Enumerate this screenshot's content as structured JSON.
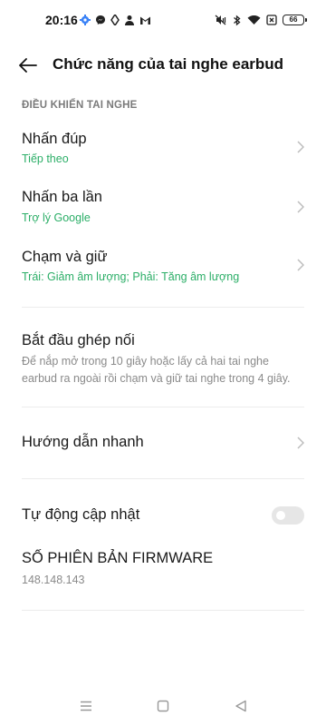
{
  "status_bar": {
    "time": "20:16",
    "battery": "66",
    "left_icons": [
      "settings-icon",
      "messenger-icon",
      "location-icon",
      "person-icon",
      "gmail-icon"
    ],
    "right_icons": [
      "mute-vibrate-icon",
      "bluetooth-icon",
      "wifi-icon",
      "no-sim-icon",
      "battery-icon"
    ]
  },
  "header": {
    "title": "Chức năng của tai nghe earbud",
    "back_icon": "arrow-left-icon"
  },
  "section": {
    "title": "ĐIỀU KHIỂN TAI NGHE"
  },
  "controls": [
    {
      "title": "Nhấn đúp",
      "value": "Tiếp theo"
    },
    {
      "title": "Nhấn ba lần",
      "value": "Trợ lý Google"
    },
    {
      "title": "Chạm và giữ",
      "value": "Trái: Giảm âm lượng; Phải: Tăng âm lượng"
    }
  ],
  "pairing": {
    "title": "Bắt đầu ghép nối",
    "description": "Để nắp mở trong 10 giây hoặc lấy cả hai tai nghe earbud ra ngoài rồi chạm và giữ tai nghe trong 4 giây."
  },
  "quick_guide": {
    "title": "Hướng dẫn nhanh"
  },
  "auto_update": {
    "title": "Tự động cập nhật",
    "enabled": false
  },
  "firmware": {
    "title": "SỐ PHIÊN BẢN FIRMWARE",
    "version": "148.148.143"
  },
  "colors": {
    "accent_green": "#2bae67",
    "toggle_off": "#e6e6e6"
  }
}
